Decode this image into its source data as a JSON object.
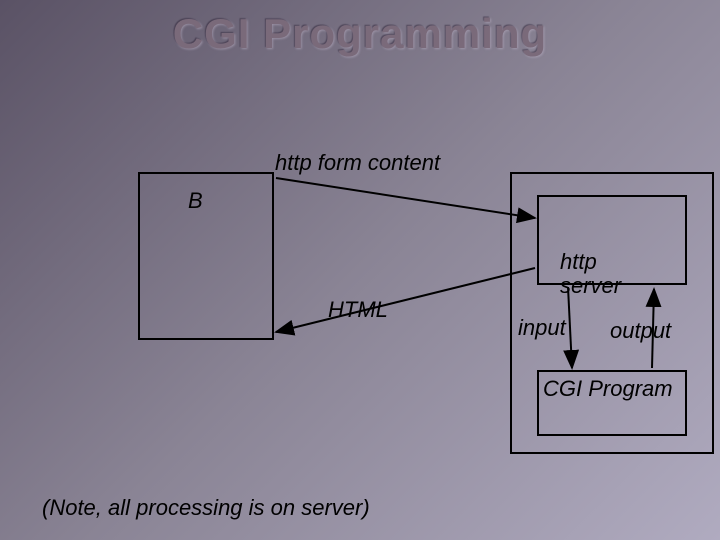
{
  "title": "CGI Programming",
  "labels": {
    "http_form": "http form content",
    "browser": "B",
    "html": "HTML",
    "http_server": "http\nserver",
    "input": "input",
    "output": "output",
    "cgi_program": "CGI Program"
  },
  "note": "(Note, all processing is on server)",
  "diagram": {
    "boxes": [
      {
        "name": "browser-box",
        "role": "Browser (B)"
      },
      {
        "name": "server-container-box",
        "role": "Server machine"
      },
      {
        "name": "http-server-box",
        "role": "http server"
      },
      {
        "name": "cgi-program-box",
        "role": "CGI Program"
      }
    ],
    "arrows": [
      {
        "from": "browser-box",
        "to": "http-server-box",
        "label": "http form content"
      },
      {
        "from": "http-server-box",
        "to": "browser-box",
        "label": "HTML"
      },
      {
        "from": "http-server-box",
        "to": "cgi-program-box",
        "label": "input"
      },
      {
        "from": "cgi-program-box",
        "to": "http-server-box",
        "label": "output"
      }
    ]
  }
}
